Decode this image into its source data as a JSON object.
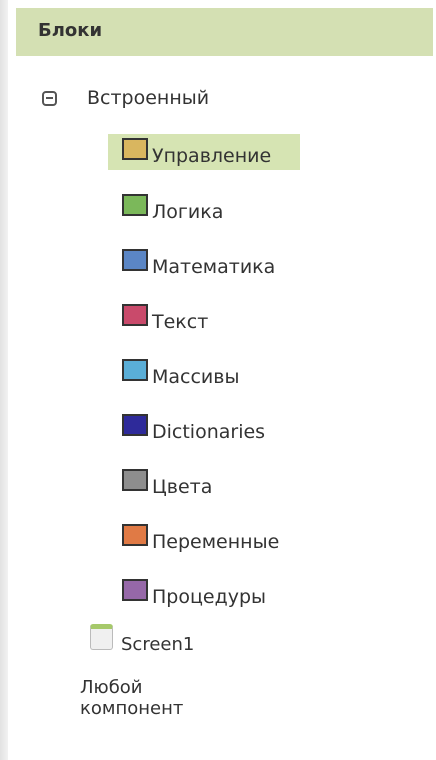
{
  "panel": {
    "title": "Блоки"
  },
  "tree": {
    "builtin_label": "Встроенный",
    "builtin_icon": "collapse-minus-icon",
    "items": [
      {
        "label": "Управление",
        "color": "#d9b65f",
        "selected": true
      },
      {
        "label": "Логика",
        "color": "#7bb85a",
        "selected": false
      },
      {
        "label": "Математика",
        "color": "#5b86c5",
        "selected": false
      },
      {
        "label": "Текст",
        "color": "#c94a6b",
        "selected": false
      },
      {
        "label": "Массивы",
        "color": "#5aaed7",
        "selected": false
      },
      {
        "label": "Dictionaries",
        "color": "#2e2a9a",
        "selected": false
      },
      {
        "label": "Цвета",
        "color": "#8e8e8e",
        "selected": false
      },
      {
        "label": "Переменные",
        "color": "#e07a45",
        "selected": false
      },
      {
        "label": "Процедуры",
        "color": "#9668a8",
        "selected": false
      }
    ],
    "screen": {
      "label": "Screen1",
      "icon": "screen-icon"
    },
    "any_component_label": "Любой компонент"
  }
}
